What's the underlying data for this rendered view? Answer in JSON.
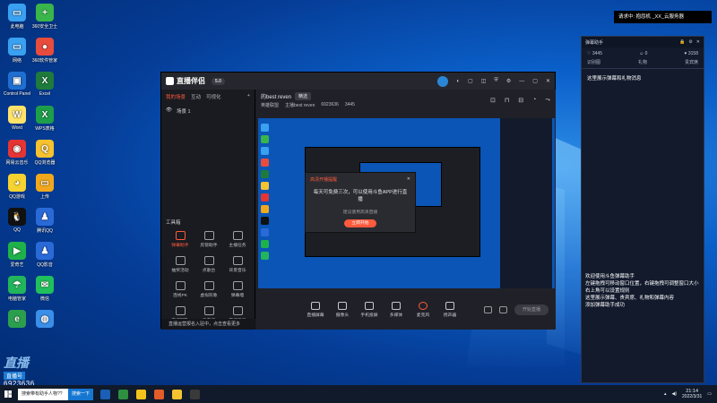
{
  "desktop": {
    "icons": [
      {
        "label": "此电脑",
        "color": "#3aa0f0",
        "glyph": "▭"
      },
      {
        "label": "360安全卫士",
        "color": "#39b54a",
        "glyph": "+"
      },
      {
        "label": "网络",
        "color": "#3aa0f0",
        "glyph": "▭"
      },
      {
        "label": "360软件管家",
        "color": "#e84c3d",
        "glyph": "●"
      },
      {
        "label": "Control Panel",
        "color": "#1f6fd1",
        "glyph": "▣"
      },
      {
        "label": "Excel",
        "color": "#1e7b3c",
        "glyph": "X"
      },
      {
        "label": "Word",
        "color": "#ffe36a",
        "glyph": "W"
      },
      {
        "label": "WPS表格",
        "color": "#1e9e4a",
        "glyph": "X"
      },
      {
        "label": "网易云音乐",
        "color": "#e43534",
        "glyph": "◉"
      },
      {
        "label": "QQ浏览器",
        "color": "#f6c230",
        "glyph": "Q"
      },
      {
        "label": "QQ游戏",
        "color": "#f6d330",
        "glyph": "◕"
      },
      {
        "label": "上传",
        "color": "#f2a81d",
        "glyph": "▭"
      },
      {
        "label": "QQ",
        "color": "#111",
        "glyph": "🐧"
      },
      {
        "label": "腾讯QQ",
        "color": "#2a6ad8",
        "glyph": "♟"
      },
      {
        "label": "爱奇艺",
        "color": "#1fb24a",
        "glyph": "▶"
      },
      {
        "label": "QQ影音",
        "color": "#2a6ad8",
        "glyph": "♟"
      },
      {
        "label": "电脑管家",
        "color": "#22b55b",
        "glyph": "☂"
      },
      {
        "label": "微信",
        "color": "#20c05c",
        "glyph": "✉"
      },
      {
        "label": "",
        "color": "#2c9f4e",
        "glyph": "e"
      },
      {
        "label": "",
        "color": "#3b8fe8",
        "glyph": "◍"
      }
    ],
    "overlay": {
      "big": "直播",
      "label": "直播号",
      "number": "6923636"
    }
  },
  "toast": {
    "text": "请求中: 抱怨机 _XX_云服务器"
  },
  "right_panel": {
    "title": "弹幕助手",
    "controls": [
      "🔒",
      "⚙",
      "✕"
    ],
    "stats": [
      {
        "icon": "♡",
        "value": "3445"
      },
      {
        "icon": "☺",
        "value": "0"
      },
      {
        "icon": "♥",
        "value": "3158"
      }
    ],
    "tabs": [
      "识别图",
      "礼物",
      "贵宾席"
    ],
    "message": "这里展示弹幕和礼物消息",
    "welcome_lines": [
      "欢迎使用斗鱼弹幕助手",
      "左键拖拽可移动窗口位置，右键拖拽可调整窗口大小",
      "右上角可以设置规则",
      "这里展示弹幕、贵宾席、礼物和弹幕内容",
      "添加弹幕助手成功"
    ]
  },
  "app": {
    "title": "直播伴侣",
    "version": "5.0",
    "title_right": [
      "◐",
      "▢",
      "◫",
      "⛨",
      "⚙",
      "—",
      "▢",
      "✕"
    ],
    "sidebar": {
      "tabs": [
        "我的场景",
        "互动",
        "可视化"
      ],
      "active_tab": "我的场景",
      "scene": "场景 1",
      "toolbox_title": "工具箱",
      "tools": [
        {
          "label": "弹幕助手",
          "active": true
        },
        {
          "label": "房管助手",
          "active": false
        },
        {
          "label": "主播任务",
          "active": false
        },
        {
          "label": "抽奖活动",
          "active": false
        },
        {
          "label": "点歌台",
          "active": false
        },
        {
          "label": "背景音乐",
          "active": false
        },
        {
          "label": "连线PK",
          "active": false
        },
        {
          "label": "虚拟形象",
          "active": false
        },
        {
          "label": "弹幕墙",
          "active": false
        },
        {
          "label": "直播回放",
          "active": false
        },
        {
          "label": "云直播",
          "active": false
        },
        {
          "label": "直播工具",
          "active": false
        }
      ],
      "bottom_notice": "直播运营报名入驻中，点击查看更多"
    },
    "room": {
      "name": "的best reven",
      "tag": "精选",
      "category": "英雄联盟",
      "anchor": "主播best reven",
      "id": "6923636",
      "hot": "3445"
    },
    "dialog": {
      "title": "高清开播提醒",
      "body": "每天可免费三次，可以使用斗鱼APP进行直播",
      "sub": "建议使用高清直播",
      "button": "立即开始"
    },
    "controls": [
      {
        "label": "直播屏幕"
      },
      {
        "label": "摄像头"
      },
      {
        "label": "手机投屏"
      },
      {
        "label": "多媒体"
      },
      {
        "label": "麦克风",
        "mic": true
      },
      {
        "label": "扬声器"
      }
    ],
    "start_button": "开始直播"
  },
  "taskbar": {
    "search_placeholder": "搜索带有助手人物??",
    "search_button": "搜索一下",
    "apps": [
      "#1a5fb5",
      "#2d8f3f",
      "#f4c21a",
      "#e35c2a",
      "#f6c230",
      "#3a3a3a"
    ],
    "time": "21:14",
    "date": "2022/3/31"
  }
}
